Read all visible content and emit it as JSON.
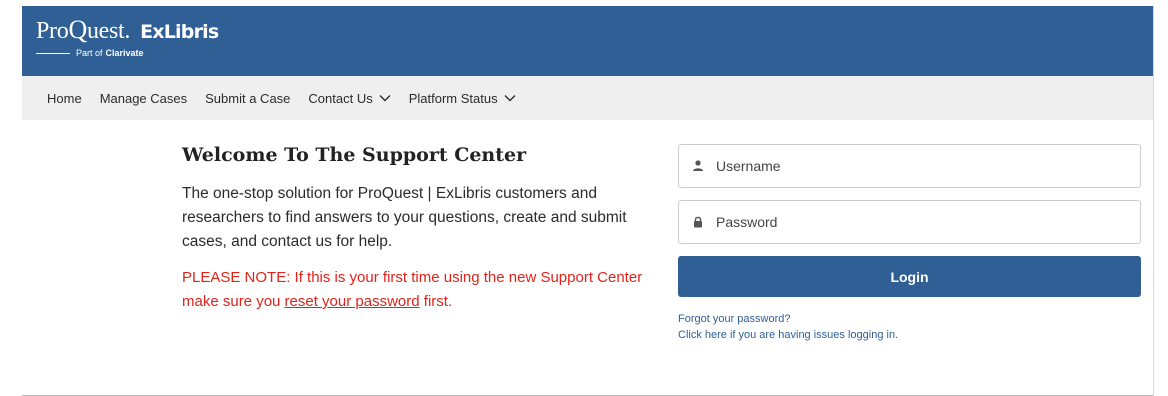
{
  "header": {
    "brand_primary_pre": "Pro",
    "brand_primary_q": "Q",
    "brand_primary_post": "uest.",
    "brand_secondary": "ExLibris",
    "tagline_prefix": "Part of",
    "tagline_brand": "Clarivate",
    "bg_color": "#2f5f94"
  },
  "nav": {
    "items": [
      {
        "label": "Home",
        "icon": ""
      },
      {
        "label": "Manage Cases",
        "icon": ""
      },
      {
        "label": "Submit a Case",
        "icon": ""
      },
      {
        "label": "Contact Us",
        "icon": "chevron-down-icon"
      },
      {
        "label": "Platform Status",
        "icon": "chevron-down-icon"
      }
    ]
  },
  "welcome": {
    "title": "Welcome To The Support Center",
    "intro": "The one-stop solution for ProQuest | ExLibris customers and researchers to find answers to your questions, create and submit cases, and contact us for help.",
    "note_before": "PLEASE NOTE: If this is your first time using the new Support Center make sure you ",
    "note_link": "reset your password",
    "note_after": " first.",
    "note_color": "#e2231a"
  },
  "login": {
    "username_placeholder": "Username",
    "username_icon": "user-icon",
    "password_placeholder": "Password",
    "password_icon": "lock-icon",
    "button_label": "Login",
    "forgot_link": "Forgot your password?",
    "issues_link": "Click here if you are having issues logging in."
  }
}
